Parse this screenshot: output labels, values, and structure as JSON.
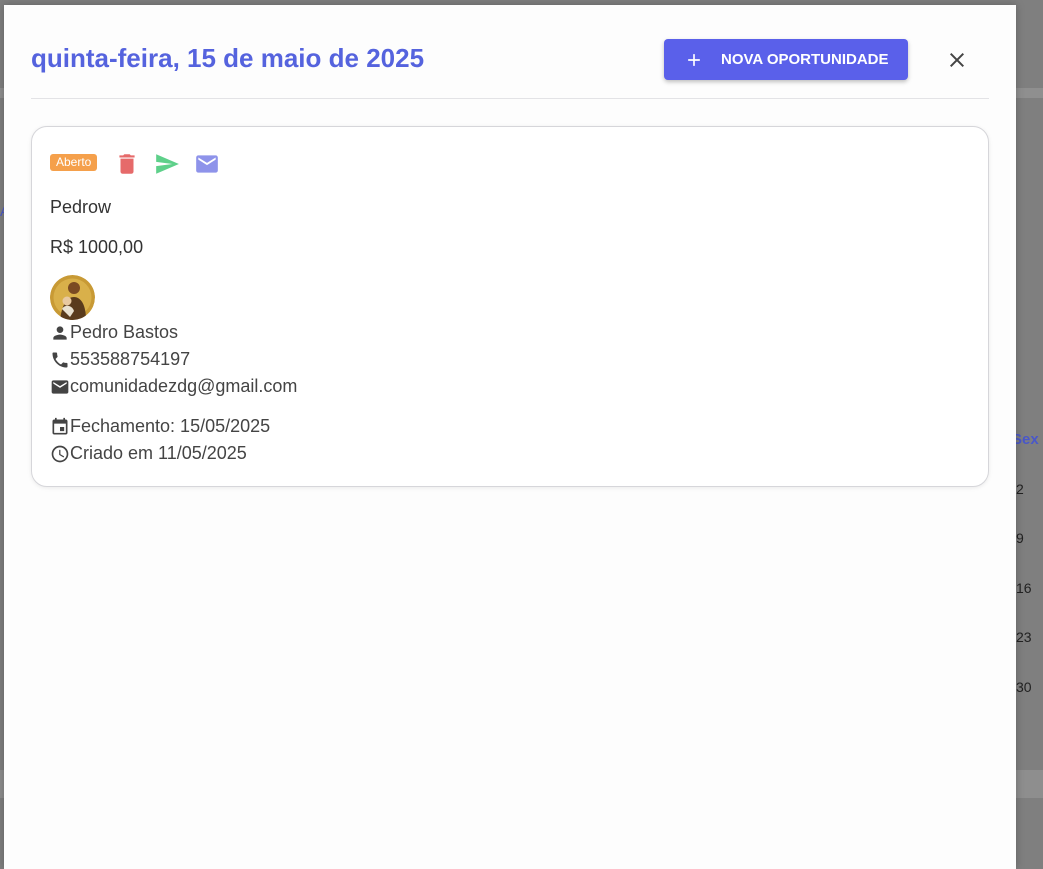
{
  "dialog": {
    "title": "quinta-feira, 15 de maio de 2025",
    "new_button_label": "NOVA OPORTUNIDADE",
    "close_icon": "close-icon",
    "add_icon": "plus-icon"
  },
  "opportunity": {
    "status": "Aberto",
    "status_color": "#f5a04b",
    "actions": [
      "delete-icon",
      "send-icon",
      "email-icon"
    ],
    "name": "Pedrow",
    "value": "R$ 1000,00",
    "contact_name": "Pedro Bastos",
    "phone": "553588754197",
    "email": "comunidadezdg@gmail.com",
    "closing": "Fechamento: 15/05/2025",
    "created": "Criado em 11/05/2025"
  },
  "background_calendar": {
    "day_header": "Sex",
    "days": [
      "2",
      "9",
      "16",
      "23",
      "30"
    ]
  },
  "colors": {
    "accent": "#5a60ea",
    "title": "#5563de",
    "delete": "#e66a6a",
    "send": "#5ed08a",
    "email": "#8e93ea"
  }
}
